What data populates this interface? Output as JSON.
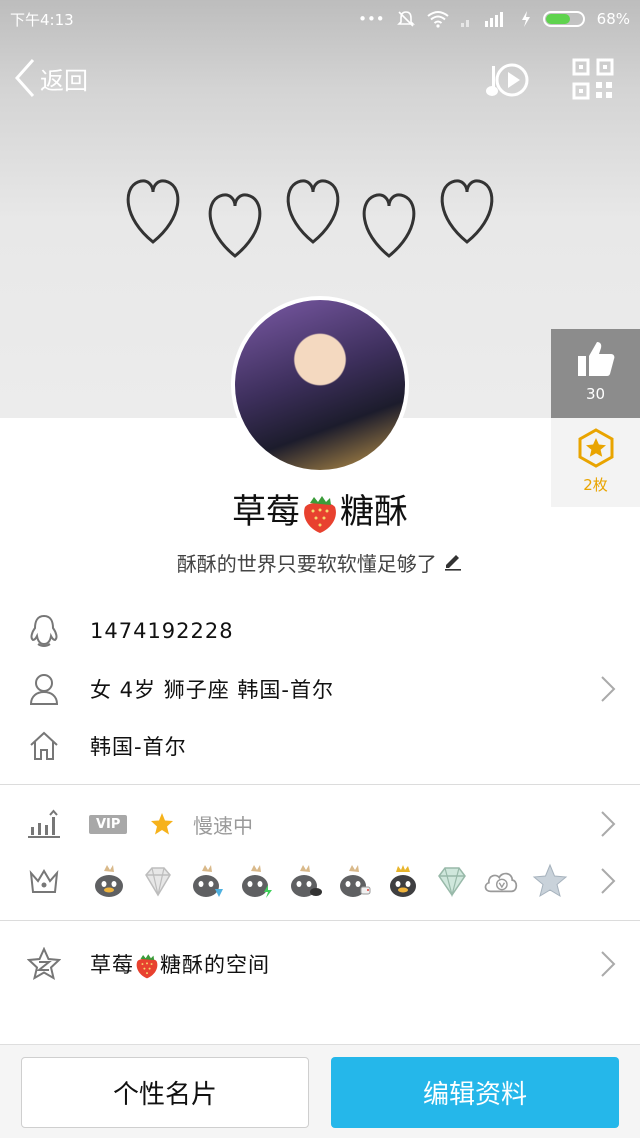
{
  "status_bar": {
    "time": "下午4:13",
    "battery": "68%",
    "battery_level": 0.68
  },
  "nav": {
    "back_label": "返回",
    "music_icon": "music-play-icon",
    "qr_icon": "qr-code-icon"
  },
  "side": {
    "like_count": "30",
    "gift_count": "2枚"
  },
  "profile": {
    "nickname_left": "草莓",
    "nickname_right": "糖酥",
    "signature": "酥酥的世界只要软软懂足够了"
  },
  "info": {
    "qq_number": "1474192228",
    "personal": "女  4岁  狮子座  韩国-首尔",
    "location": "韩国-首尔"
  },
  "vip": {
    "tag": "VIP",
    "speed_text": "慢速中"
  },
  "space": {
    "left": "草莓",
    "right": "糖酥的空间"
  },
  "buttons": {
    "card": "个性名片",
    "edit": "编辑资料"
  },
  "colors": {
    "accent": "#25b7ea",
    "gift": "#e9a400",
    "like_panel": "#8c8c8c"
  }
}
